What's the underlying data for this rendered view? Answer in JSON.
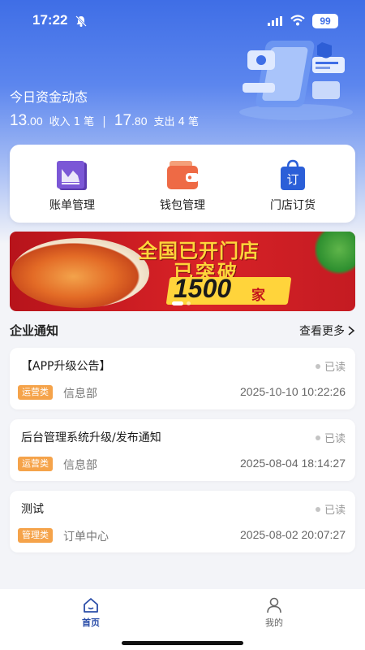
{
  "status_bar": {
    "time": "17:22",
    "battery": "99"
  },
  "funds": {
    "title": "今日资金动态",
    "income_int": "13",
    "income_dec": ".00",
    "income_label": "收入 1 笔",
    "separator": "|",
    "expense_int": "17",
    "expense_dec": ".80",
    "expense_label": "支出 4 笔"
  },
  "menu": [
    {
      "label": "账单管理",
      "icon": "bill-icon"
    },
    {
      "label": "钱包管理",
      "icon": "wallet-icon"
    },
    {
      "label": "门店订货",
      "icon": "order-bag-icon"
    }
  ],
  "banner": {
    "line1": "全国已开门店",
    "line2": "已突破",
    "number": "1500",
    "unit": "家"
  },
  "notices": {
    "title": "企业通知",
    "more": "查看更多",
    "items": [
      {
        "title": "【APP升级公告】",
        "status": "已读",
        "tag": "运营类",
        "dept": "信息部",
        "time": "2025-10-10 10:22:26"
      },
      {
        "title": "后台管理系统升级/发布通知",
        "status": "已读",
        "tag": "运营类",
        "dept": "信息部",
        "time": "2025-08-04 18:14:27"
      },
      {
        "title": "测试",
        "status": "已读",
        "tag": "管理类",
        "dept": "订单中心",
        "time": "2025-08-02 20:07:27"
      }
    ]
  },
  "tabbar": {
    "home": "首页",
    "mine": "我的"
  },
  "colors": {
    "primary": "#3f6ee6",
    "tag": "#f5a34a",
    "active_tab": "#2a4da8"
  }
}
